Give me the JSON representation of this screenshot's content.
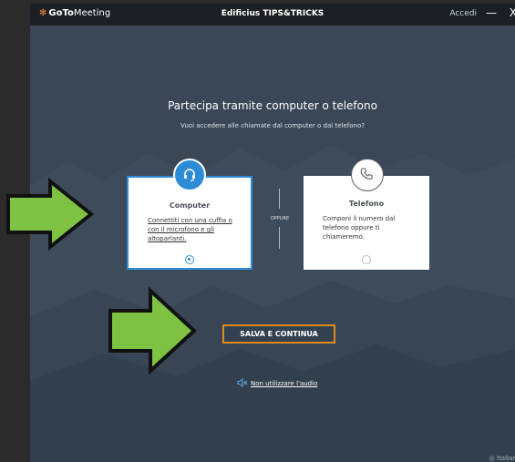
{
  "titlebar": {
    "logo_goto": "GoTo",
    "logo_meeting": "Meeting",
    "window_title": "Edificius TIPS&TRICKS",
    "login_label": "Accedi",
    "minimize_glyph": "—",
    "close_glyph": "X"
  },
  "main": {
    "heading": "Partecipa tramite computer o telefono",
    "subheading": "Vuoi accedere alle chiamate dal computer o dal telefono?",
    "separator_label": "OPPURE",
    "computer_card": {
      "title": "Computer",
      "description": "Connettiti con una cuffia o con il microfono e gli altoparlanti.",
      "selected": true,
      "icon": "headset-icon"
    },
    "phone_card": {
      "title": "Telefono",
      "description": "Componi il numero dal telefono oppure ti chiameremo.",
      "selected": false,
      "icon": "phone-icon"
    },
    "save_button_label": "SALVA E CONTINUA",
    "no_audio_label": "Non utilizzare l'audio",
    "language_label": "Italiano"
  },
  "colors": {
    "window_bg": "#3b4656",
    "titlebar_bg": "#1b1f24",
    "accent_blue": "#2d8cd8",
    "accent_orange": "#e08a1e",
    "arrow_green": "#7dc242"
  }
}
